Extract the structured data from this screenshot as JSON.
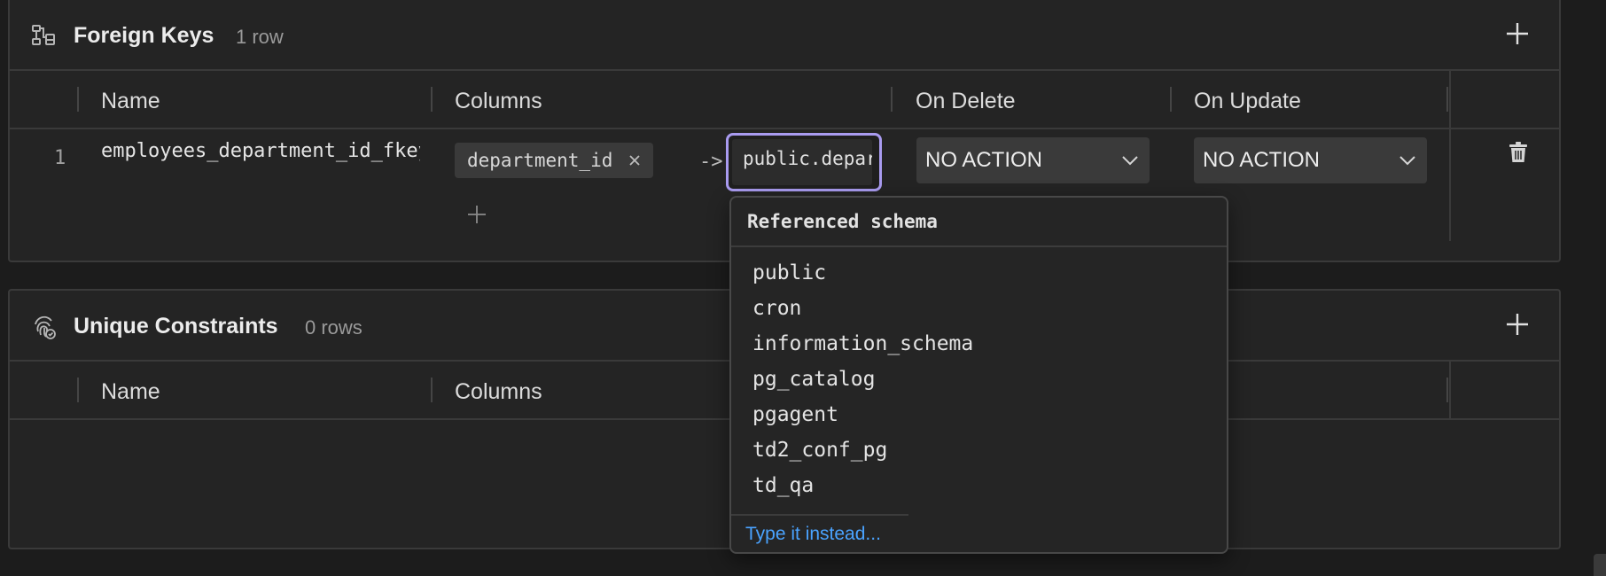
{
  "foreign_keys": {
    "title": "Foreign Keys",
    "count": "1 row",
    "columns": {
      "name": "Name",
      "columns": "Columns",
      "on_delete": "On Delete",
      "on_update": "On Update"
    },
    "rows": [
      {
        "index": "1",
        "name": "employees_department_id_fkey",
        "column_chip": "department_id",
        "arrow": "->",
        "reference": "public.departments",
        "on_delete": "NO ACTION",
        "on_update": "NO ACTION"
      }
    ]
  },
  "unique_constraints": {
    "title": "Unique Constraints",
    "count": "0 rows",
    "columns": {
      "name": "Name",
      "columns": "Columns"
    }
  },
  "schema_dropdown": {
    "title": "Referenced schema",
    "options": [
      "public",
      "cron",
      "information_schema",
      "pg_catalog",
      "pgagent",
      "td2_conf_pg",
      "td_qa"
    ],
    "type_instead": "Type it instead..."
  },
  "colors": {
    "accent_focus": "#a99bf0",
    "link": "#4aa3ff",
    "panel_bg": "#242424",
    "page_bg": "#1c1c1c"
  },
  "icons": {
    "fk_panel": "foreign-key-icon",
    "uc_panel": "fingerprint-icon",
    "add": "plus-icon",
    "remove_chip": "close-icon",
    "dropdown": "chevron-down-icon",
    "delete_row": "trash-icon"
  }
}
